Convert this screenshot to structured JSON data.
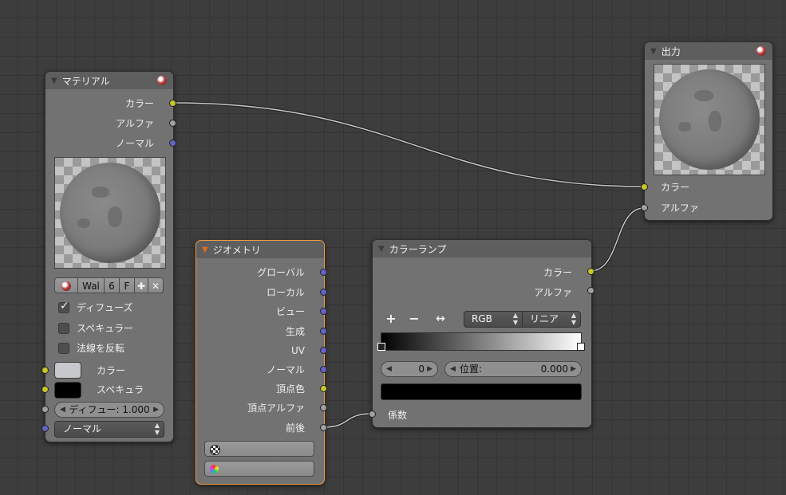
{
  "material_node": {
    "title": "マテリアル",
    "outputs": [
      "カラー",
      "アルファ",
      "ノーマル"
    ],
    "browse": {
      "name": "Wal",
      "users": "6",
      "fake": "F"
    },
    "checks": [
      {
        "label": "ディフューズ",
        "checked": true
      },
      {
        "label": "スペキュラー",
        "checked": false
      },
      {
        "label": "法線を反転",
        "checked": false
      }
    ],
    "inputs": {
      "color_label": "カラー",
      "spec_label": "スペキュラ",
      "color": "#c7c8cc",
      "spec_color": "#000000"
    },
    "diffuse_field": "ディフュー: 1.000",
    "normal_select": "ノーマル"
  },
  "geometry_node": {
    "title": "ジオメトリ",
    "outputs": [
      "グローバル",
      "ローカル",
      "ビュー",
      "生成",
      "UV",
      "ノーマル",
      "頂点色",
      "頂点アルファ",
      "前後"
    ]
  },
  "colorramp_node": {
    "title": "カラーランプ",
    "outputs": [
      "カラー",
      "アルファ"
    ],
    "color_mode": "RGB",
    "interpolation": "リニア",
    "index_field": "0",
    "position_label": "位置:",
    "position_value": "0.000",
    "input_label": "係数",
    "active_color": "#000000"
  },
  "output_node": {
    "title": "出力",
    "inputs": [
      "カラー",
      "アルファ"
    ]
  },
  "colors": {
    "socket_color": "#c7c729",
    "socket_value": "#a1a1a1",
    "socket_vector": "#6363c7",
    "active_node_border": "#f0a040"
  }
}
